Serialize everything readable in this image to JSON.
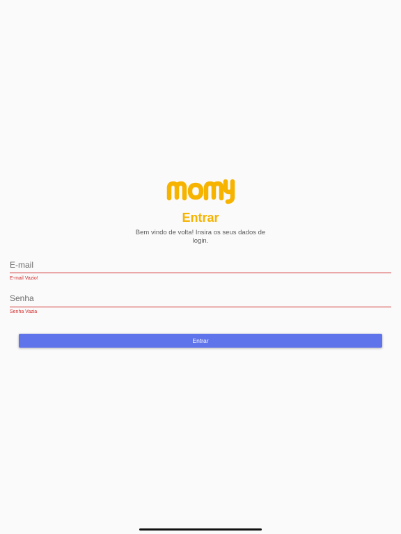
{
  "brand": {
    "logo_text": "momy",
    "primary_color": "#f6b300",
    "accent_color": "#5f73ea",
    "error_color": "#d32f2f"
  },
  "login": {
    "title": "Entrar",
    "subtitle": "Bem vindo de volta! Insira os seus dados de login.",
    "email": {
      "placeholder": "E-mail",
      "value": "",
      "error": "E-mail Vazio!"
    },
    "password": {
      "placeholder": "Senha",
      "value": "",
      "error": "Senha Vazia"
    },
    "submit_label": "Entrar"
  }
}
